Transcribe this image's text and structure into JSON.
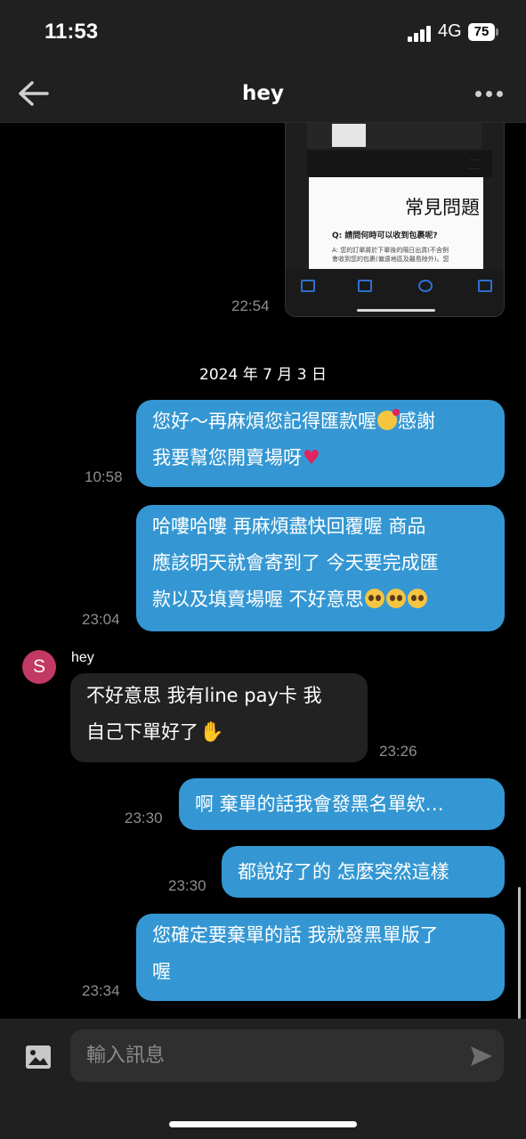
{
  "status_bar": {
    "time": "11:53",
    "network": "4G",
    "battery": "75"
  },
  "header": {
    "title": "hey",
    "back_icon": "arrow-left-icon",
    "more_icon": "more-horizontal-icon"
  },
  "screenshot_message": {
    "doc_title": "常見問題",
    "doc_question": "Q: 請問何時可以收到包裹呢?",
    "doc_answer_1": "A: 您的訂單將於下單後的隔日出貨(不含例",
    "doc_answer_2": "會收到您的包裹(偏遠地區及離島除外)。您",
    "time": "22:54"
  },
  "date_separator": "2024 年 7 月 3 日",
  "messages": [
    {
      "id": "m1",
      "line1": "您好～再麻煩您記得匯款喔",
      "line1b": "感謝",
      "line2": "我要幫您開賣場呀",
      "time": "10:58"
    },
    {
      "id": "m2",
      "line1": "哈嘍哈嘍 再麻煩盡快回覆喔 商品",
      "line2": "應該明天就會寄到了 今天要完成匯",
      "line3": "款以及填賣場喔 不好意思",
      "time": "23:04"
    },
    {
      "id": "m3",
      "sender": "hey",
      "avatar_letter": "S",
      "line1": "不好意思 我有line pay卡 我",
      "line2": "自己下單好了",
      "time": "23:26"
    },
    {
      "id": "m4",
      "line1": "啊 棄單的話我會發黑名單欸…",
      "time": "23:30"
    },
    {
      "id": "m5",
      "line1": "都說好了的 怎麼突然這樣",
      "time": "23:30"
    },
    {
      "id": "m6",
      "line1": "您確定要棄單的話 我就發黑單版了",
      "line2": "喔",
      "time": "23:34"
    }
  ],
  "input": {
    "placeholder": "輸入訊息",
    "image_icon": "image-icon",
    "send_icon": "send-icon"
  },
  "colors": {
    "outgoing_bubble": "#3497d3",
    "incoming_bubble": "#222222",
    "avatar": "#c23a64"
  }
}
